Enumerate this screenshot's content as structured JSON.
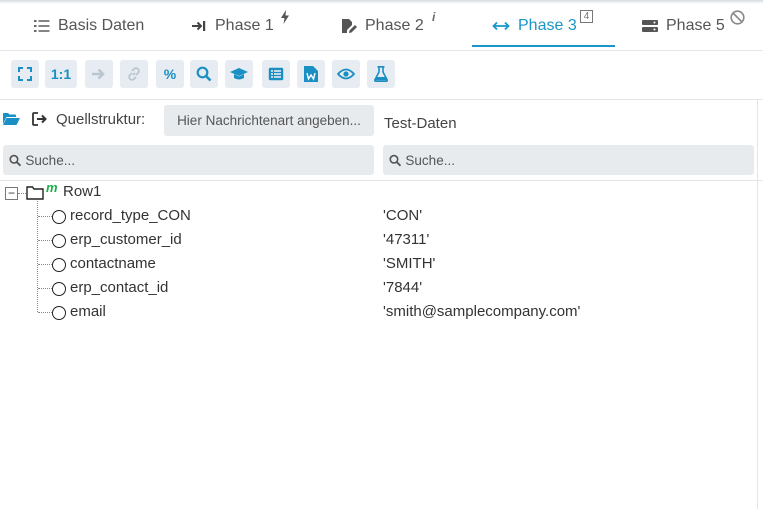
{
  "tabs": [
    {
      "label": "Basis Daten",
      "icon": "list-icon"
    },
    {
      "label": "Phase 1",
      "icon": "arrow-to-line-icon",
      "badge_icon": "bolt-icon"
    },
    {
      "label": "Phase 2",
      "icon": "file-edit-icon",
      "badge": "i"
    },
    {
      "label": "Phase 3",
      "icon": "arrows-horizontal-icon",
      "badge": "4",
      "active": true
    },
    {
      "label": "Phase 5",
      "icon": "server-icon",
      "badge_icon": "ban-icon"
    }
  ],
  "toolbar": {
    "one_to_one": "1:1",
    "percent": "%"
  },
  "source": {
    "label": "Quellstruktur:",
    "message_button": "Hier Nachrichtenart angeben...",
    "test_label": "Test-Daten"
  },
  "search": {
    "left_placeholder": "Suche...",
    "right_placeholder": "Suche..."
  },
  "tree": {
    "root": {
      "label": "Row1",
      "badge": "m"
    },
    "children": [
      {
        "label": "record_type_CON",
        "value": "'CON'"
      },
      {
        "label": "erp_customer_id",
        "value": "'47311'"
      },
      {
        "label": "contactname",
        "value": "'SMITH'"
      },
      {
        "label": "erp_contact_id",
        "value": "'7844'"
      },
      {
        "label": "email",
        "value": "'smith@samplecompany.com'"
      }
    ]
  },
  "colors": {
    "accent": "#1a96c9",
    "toolbar_button_bg": "#e6ecf1",
    "search_bg": "#e7ebee",
    "badge_green": "#1fae4b"
  }
}
